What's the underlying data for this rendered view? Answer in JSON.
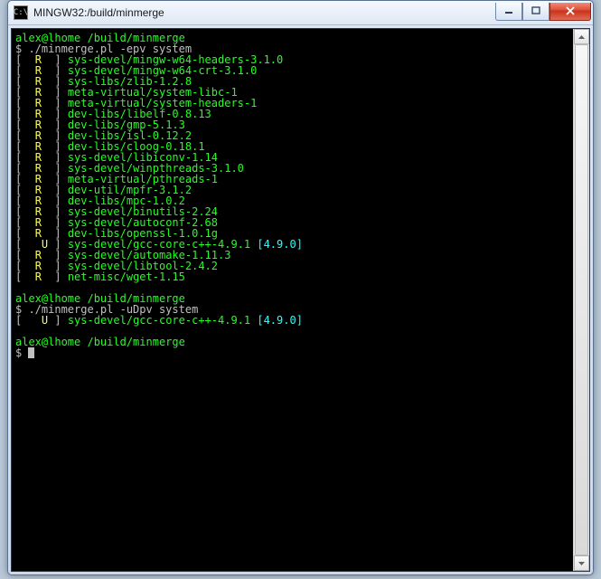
{
  "window": {
    "title": "MINGW32:/build/minmerge"
  },
  "icons": {
    "app": "C:\\",
    "min": "–",
    "max": "□",
    "close": "×",
    "up": "▲",
    "down": "▼"
  },
  "blocks": [
    {
      "prompt": {
        "user": "alex@lhome",
        "path": "/build/minmerge"
      },
      "command": "./minmerge.pl -epv system",
      "lines": [
        {
          "flag": "R",
          "pkg": "sys-devel/mingw-w64-headers-3.1.0"
        },
        {
          "flag": "R",
          "pkg": "sys-devel/mingw-w64-crt-3.1.0"
        },
        {
          "flag": "R",
          "pkg": "sys-libs/zlib-1.2.8"
        },
        {
          "flag": "R",
          "pkg": "meta-virtual/system-libc-1"
        },
        {
          "flag": "R",
          "pkg": "meta-virtual/system-headers-1"
        },
        {
          "flag": "R",
          "pkg": "dev-libs/libelf-0.8.13"
        },
        {
          "flag": "R",
          "pkg": "dev-libs/gmp-5.1.3"
        },
        {
          "flag": "R",
          "pkg": "dev-libs/isl-0.12.2"
        },
        {
          "flag": "R",
          "pkg": "dev-libs/cloog-0.18.1"
        },
        {
          "flag": "R",
          "pkg": "sys-devel/libiconv-1.14"
        },
        {
          "flag": "R",
          "pkg": "sys-devel/winpthreads-3.1.0"
        },
        {
          "flag": "R",
          "pkg": "meta-virtual/pthreads-1"
        },
        {
          "flag": "R",
          "pkg": "dev-util/mpfr-3.1.2"
        },
        {
          "flag": "R",
          "pkg": "dev-libs/mpc-1.0.2"
        },
        {
          "flag": "R",
          "pkg": "sys-devel/binutils-2.24"
        },
        {
          "flag": "R",
          "pkg": "sys-devel/autoconf-2.68"
        },
        {
          "flag": "R",
          "pkg": "dev-libs/openssl-1.0.1g"
        },
        {
          "flag": "U",
          "pkg": "sys-devel/gcc-core-c++-4.9.1",
          "slot": "[4.9.0]"
        },
        {
          "flag": "R",
          "pkg": "sys-devel/automake-1.11.3"
        },
        {
          "flag": "R",
          "pkg": "sys-devel/libtool-2.4.2"
        },
        {
          "flag": "R",
          "pkg": "net-misc/wget-1.15"
        }
      ]
    },
    {
      "prompt": {
        "user": "alex@lhome",
        "path": "/build/minmerge"
      },
      "command": "./minmerge.pl -uDpv system",
      "lines": [
        {
          "flag": "U",
          "pkg": "sys-devel/gcc-core-c++-4.9.1",
          "slot": "[4.9.0]"
        }
      ]
    },
    {
      "prompt": {
        "user": "alex@lhome",
        "path": "/build/minmerge"
      },
      "cursor": true
    }
  ]
}
